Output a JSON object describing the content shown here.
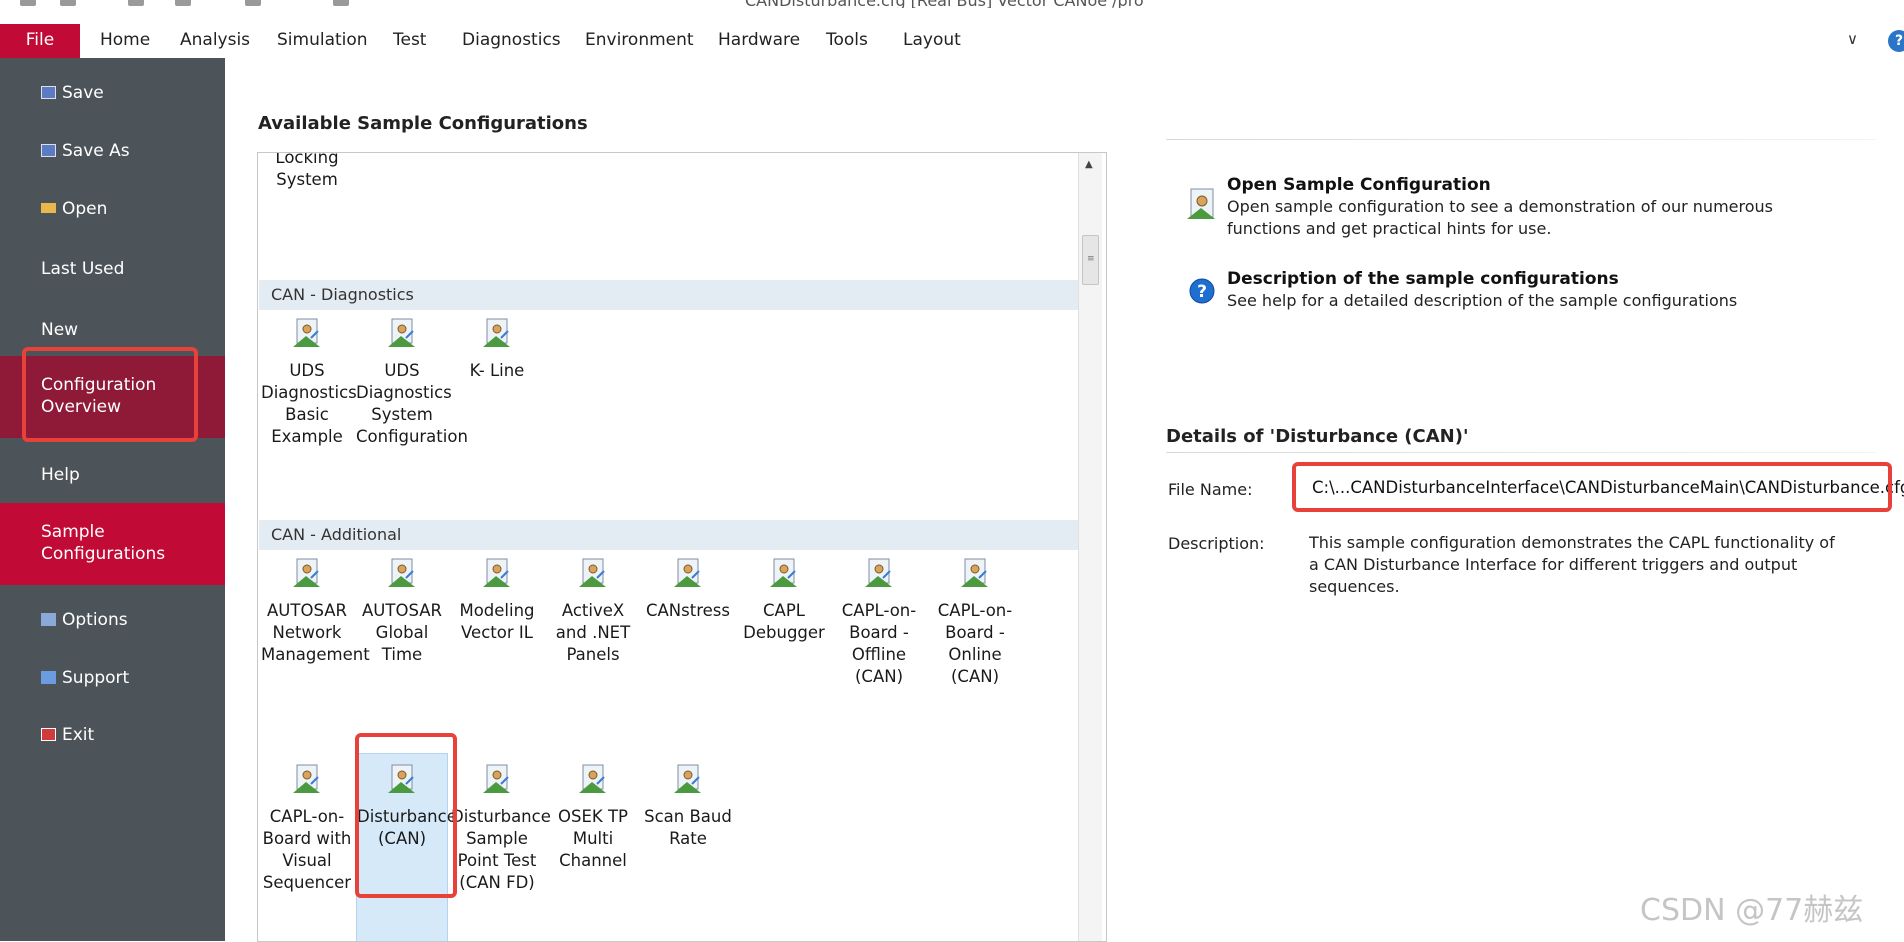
{
  "title_bar": {
    "text": "CANDisturbance.cfg   [Real Bus]   Vector CANoe /pro"
  },
  "ribbon": {
    "file_tab": "File",
    "tabs": [
      "Home",
      "Analysis",
      "Simulation",
      "Test",
      "Diagnostics",
      "Environment",
      "Hardware",
      "Tools",
      "Layout"
    ],
    "collapse_glyph": "∨",
    "help_glyph": "?"
  },
  "backstage_nav": {
    "items": [
      {
        "label": "Save",
        "icon": "floppy-disk-icon"
      },
      {
        "label": "Save As",
        "icon": "save-as-icon"
      },
      {
        "label": "Open",
        "icon": "folder-open-icon"
      },
      {
        "label": "Last Used"
      },
      {
        "label": "New"
      },
      {
        "label": "Configuration Overview",
        "state": "active"
      },
      {
        "label": "Help"
      },
      {
        "label": "Sample Configurations",
        "state": "selected"
      },
      {
        "label": "Options",
        "icon": "options-icon"
      },
      {
        "label": "Support",
        "icon": "support-icon"
      },
      {
        "label": "Exit",
        "icon": "exit-icon"
      }
    ]
  },
  "gallery": {
    "title": "Available Sample Configurations",
    "partial_item": "Locking System",
    "groups": [
      {
        "header": "CAN - Diagnostics",
        "items": [
          "UDS Diagnostics Basic Example",
          "UDS Diagnostics System Configuration",
          "K- Line"
        ]
      },
      {
        "header": "CAN - Additional",
        "items": [
          "AUTOSAR Network Management",
          "AUTOSAR Global Time",
          "Modeling Vector IL",
          "ActiveX and .NET Panels",
          "CANstress",
          "CAPL Debugger",
          "CAPL-on-Board - Offline (CAN)",
          "CAPL-on-Board - Online (CAN)",
          "CAPL-on-Board with Visual Sequencer",
          "Disturbance (CAN)",
          "Disturbance Sample Point Test (CAN FD)",
          "OSEK TP Multi Channel",
          "Scan Baud Rate"
        ],
        "selected": "Disturbance (CAN)"
      }
    ]
  },
  "actions": {
    "open_sample": {
      "title": "Open Sample Configuration",
      "description": "Open sample configuration to see a demonstration of our numerous functions and get practical hints for use."
    },
    "description_help": {
      "title": "Description of the sample configurations",
      "description": "See help for a detailed description of the sample configurations"
    }
  },
  "details": {
    "title": "Details of 'Disturbance (CAN)'",
    "file_name_label": "File Name:",
    "file_name": "C:\\...CANDisturbanceInterface\\CANDisturbanceMain\\CANDisturbance.cfg",
    "description_label": "Description:",
    "description": "This sample configuration demonstrates the CAPL functionality of a CAN Disturbance Interface for different triggers and output sequences."
  },
  "watermark": "CSDN @77赫兹",
  "colors": {
    "accent_red": "#c10a35",
    "nav_bg": "#4d5459",
    "nav_active": "#8e1a38",
    "annotation_red": "#e8413a",
    "group_header_bg": "#e4ecf3",
    "selection_bg": "#d6e9f8"
  }
}
